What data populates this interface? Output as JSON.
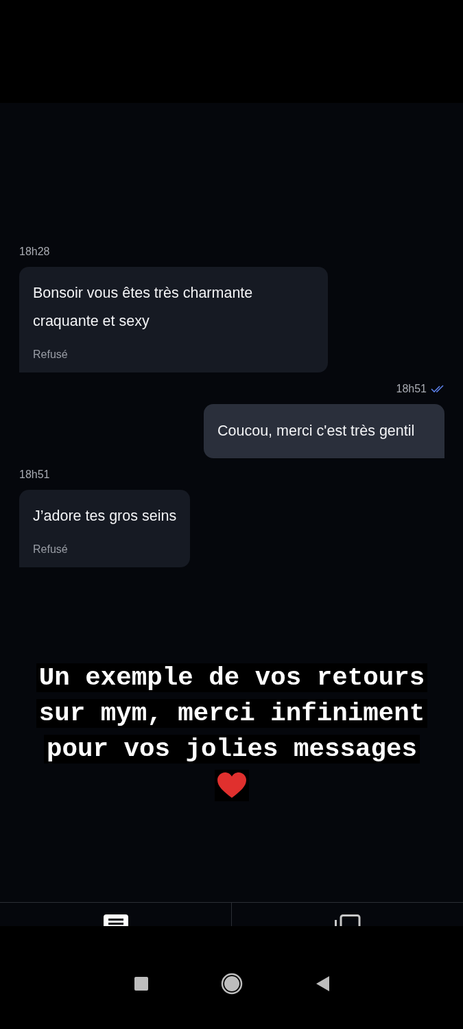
{
  "messages": [
    {
      "kind": "incoming",
      "time": "18h28",
      "text": "Bonsoir vous êtes très charmante craquante et sexy",
      "status": "Refusé"
    },
    {
      "kind": "outgoing",
      "time": "18h51",
      "text": "Coucou, merci c'est très gentil",
      "read": true
    },
    {
      "kind": "incoming",
      "time": "18h51",
      "text": "J’adore tes gros seins",
      "status": "Refusé"
    }
  ],
  "caption": "Un exemple de vos retours sur mym, merci infiniment pour vos jolies messages"
}
